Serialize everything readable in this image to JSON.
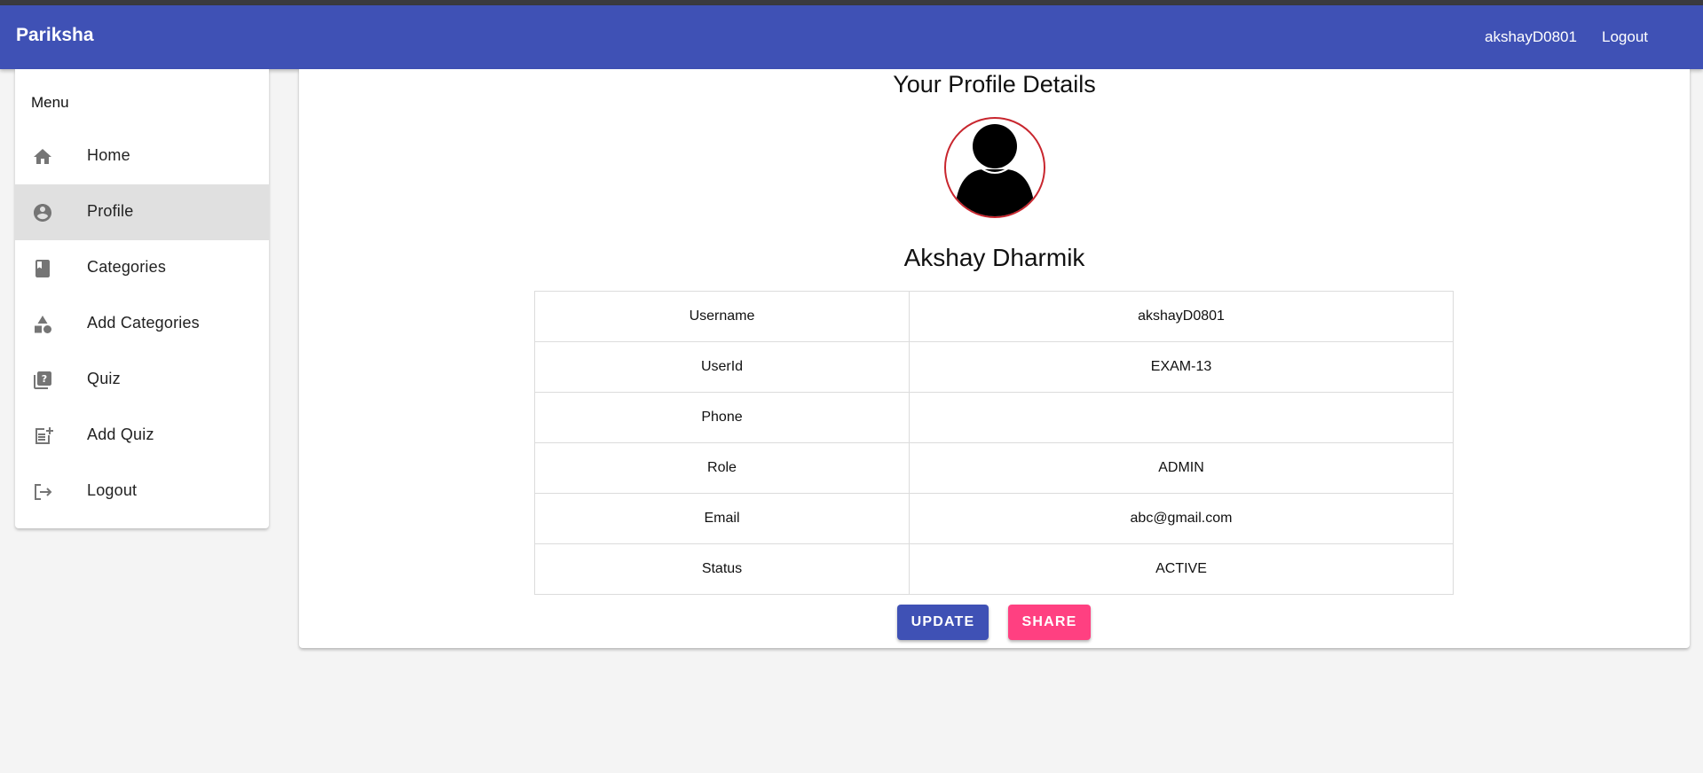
{
  "navbar": {
    "brand": "Pariksha",
    "username": "akshayD0801",
    "logout": "Logout"
  },
  "sidebar": {
    "title": "Menu",
    "items": [
      {
        "label": "Home",
        "icon": "home-icon"
      },
      {
        "label": "Profile",
        "icon": "account-circle-icon",
        "active": true
      },
      {
        "label": "Categories",
        "icon": "book-icon"
      },
      {
        "label": "Add Categories",
        "icon": "category-shapes-icon"
      },
      {
        "label": "Quiz",
        "icon": "quiz-icon"
      },
      {
        "label": "Add Quiz",
        "icon": "post-add-icon"
      },
      {
        "label": "Logout",
        "icon": "logout-icon"
      }
    ]
  },
  "profile": {
    "title": "Your Profile Details",
    "avatar_icon": "user-silhouette-icon",
    "full_name": "Akshay Dharmik",
    "rows": [
      {
        "key": "Username",
        "value": "akshayD0801"
      },
      {
        "key": "UserId",
        "value": "EXAM-13"
      },
      {
        "key": "Phone",
        "value": ""
      },
      {
        "key": "Role",
        "value": "ADMIN"
      },
      {
        "key": "Email",
        "value": "abc@gmail.com"
      },
      {
        "key": "Status",
        "value": "ACTIVE"
      }
    ],
    "update_label": "UPDATE",
    "share_label": "SHARE"
  },
  "colors": {
    "primary": "#3f51b5",
    "accent": "#ff4081",
    "avatar_border": "#c8262e",
    "active_menu_bg": "#e0e0e0",
    "icon_gray": "#757575"
  }
}
